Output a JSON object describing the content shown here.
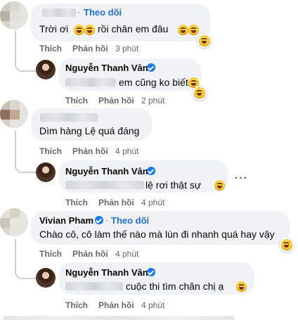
{
  "comments": [
    {
      "author": "",
      "follow": "Theo dõi",
      "text_a": "Trời ơi",
      "text_b": "rồi chân em đâu",
      "actions": {
        "like": "Thích",
        "reply": "Phản hồi",
        "time": "3 phút"
      },
      "reply": {
        "author": "Nguyễn Thanh Vân",
        "text": "em cũng ko biết",
        "actions": {
          "like": "Thích",
          "reply": "Phản hồi",
          "time": "2 phút"
        }
      }
    },
    {
      "author": "",
      "text": "Dìm hàng Lệ quá đáng",
      "actions": {
        "like": "Thích",
        "reply": "Phản hồi",
        "time": "4 phút"
      },
      "reply": {
        "author": "Nguyễn Thanh Vân",
        "text": "lệ rơi thật sự",
        "actions": {
          "like": "Thích",
          "reply": "Phản hồi",
          "time": "4 phút"
        }
      }
    },
    {
      "author": "Vivian Pham",
      "follow": "Theo dõi",
      "text": "Chào cô, cô làm thế nào mà lùn đi nhanh quá hay vậy",
      "actions": {
        "like": "Thích",
        "reply": "Phản hồi",
        "time": "4 phút"
      },
      "reply": {
        "author": "Nguyễn Thanh Vân",
        "text": "cuộc thi tìm chân chị ạ",
        "actions": {
          "like": "Thích",
          "reply": "Phản hồi",
          "time": "4 phút"
        }
      }
    }
  ],
  "separator_dot": "·",
  "more_icon": "more-horizontal-icon",
  "accent": "#216fdb",
  "verified_color": "#1877f2"
}
